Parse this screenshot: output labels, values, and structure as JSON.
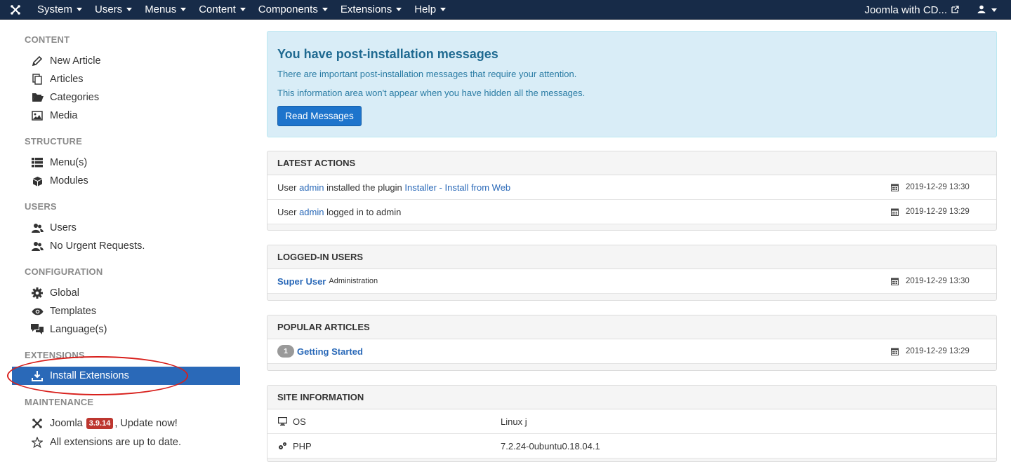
{
  "navbar": {
    "menus": [
      "System",
      "Users",
      "Menus",
      "Content",
      "Components",
      "Extensions",
      "Help"
    ],
    "site_name": "Joomla with CD...",
    "logo_icon": "joomla-logo-icon",
    "user_icon": "user-icon"
  },
  "sidebar": {
    "sections": [
      {
        "title": "CONTENT",
        "items": [
          {
            "label": "New Article",
            "icon": "pencil-icon"
          },
          {
            "label": "Articles",
            "icon": "copy-icon"
          },
          {
            "label": "Categories",
            "icon": "folder-open-icon"
          },
          {
            "label": "Media",
            "icon": "image-icon"
          }
        ]
      },
      {
        "title": "STRUCTURE",
        "items": [
          {
            "label": "Menu(s)",
            "icon": "list-icon"
          },
          {
            "label": "Modules",
            "icon": "cube-icon"
          }
        ]
      },
      {
        "title": "USERS",
        "items": [
          {
            "label": "Users",
            "icon": "users-icon"
          },
          {
            "label": "No Urgent Requests.",
            "icon": "users-icon"
          }
        ]
      },
      {
        "title": "CONFIGURATION",
        "items": [
          {
            "label": "Global",
            "icon": "gear-icon"
          },
          {
            "label": "Templates",
            "icon": "eye-icon"
          },
          {
            "label": "Language(s)",
            "icon": "comments-icon"
          }
        ]
      },
      {
        "title": "EXTENSIONS",
        "items": [
          {
            "label": "Install Extensions",
            "icon": "download-icon",
            "active": true
          }
        ]
      },
      {
        "title": "MAINTENANCE",
        "items": [
          {
            "label_prefix": "Joomla",
            "version": "3.9.14",
            "label_suffix": ", Update now!",
            "icon": "joomla-icon"
          },
          {
            "label": "All extensions are up to date.",
            "icon": "star-outline-icon"
          }
        ]
      }
    ]
  },
  "alert": {
    "title": "You have post-installation messages",
    "line1": "There are important post-installation messages that require your attention.",
    "line2": "This information area won't appear when you have hidden all the messages.",
    "button": "Read Messages"
  },
  "latest_actions": {
    "title": "LATEST ACTIONS",
    "rows": [
      {
        "pre": "User ",
        "user": "admin",
        "mid": " installed the plugin ",
        "target": "Installer - Install from Web",
        "date": "2019-12-29 13:30"
      },
      {
        "pre": "User ",
        "user": "admin",
        "mid": " logged in to admin",
        "target": "",
        "date": "2019-12-29 13:29"
      }
    ]
  },
  "logged_in_users": {
    "title": "LOGGED-IN USERS",
    "rows": [
      {
        "name": "Super User",
        "area": "Administration",
        "date": "2019-12-29 13:30"
      }
    ]
  },
  "popular_articles": {
    "title": "POPULAR ARTICLES",
    "rows": [
      {
        "hits": "1",
        "title": "Getting Started",
        "date": "2019-12-29 13:29"
      }
    ]
  },
  "site_information": {
    "title": "SITE INFORMATION",
    "rows": [
      {
        "label": "OS",
        "value": "Linux j",
        "icon": "desktop-icon"
      },
      {
        "label": "PHP",
        "value": "7.2.24-0ubuntu0.18.04.1",
        "icon": "cogs-icon"
      }
    ]
  },
  "colors": {
    "navbar": "#172b48",
    "active_item": "#2a69b8",
    "alert_bg": "#d9edf7",
    "primary_button": "#1d74cc",
    "annotation": "#d8201c"
  }
}
